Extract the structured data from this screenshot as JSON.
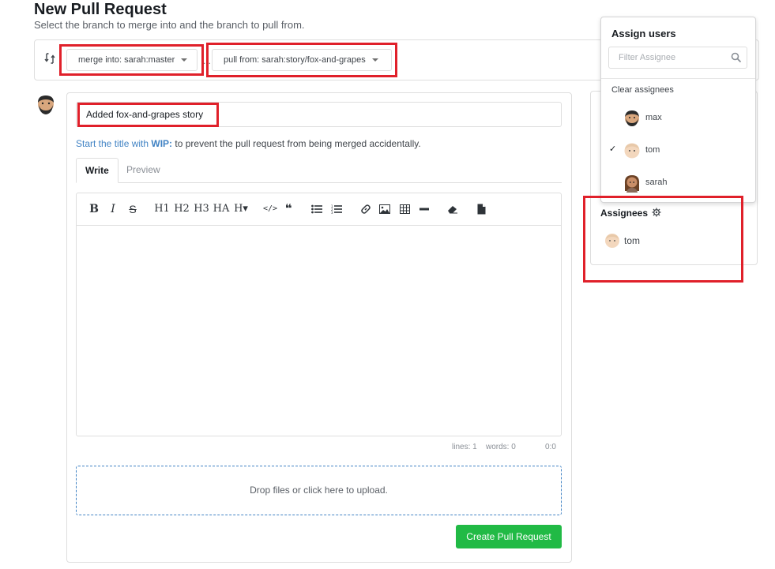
{
  "header": {
    "title": "New Pull Request",
    "subtitle": "Select the branch to merge into and the branch to pull from."
  },
  "branches": {
    "merge_into": "merge into: sarah:master",
    "separator": "...",
    "pull_from": "pull from: sarah:story/fox-and-grapes"
  },
  "form": {
    "title_value": "Added fox-and-grapes story",
    "wip_prefix": "Start the title with",
    "wip_keyword": "WIP:",
    "wip_suffix": "to prevent the pull request from being merged accidentally.",
    "tabs": [
      "Write",
      "Preview"
    ],
    "toolbar": {
      "bold": "B",
      "italic": "I",
      "strikethrough": "S",
      "h1": "H1",
      "h2": "H2",
      "h3": "H3",
      "h_bigger": "HA",
      "h_smaller": "H▾",
      "code": "</>",
      "quote": "❝",
      "unordered_list": "unordered-list-icon",
      "ordered_list": "ordered-list-icon",
      "link": "link-icon",
      "image": "image-icon",
      "table": "table-icon",
      "horizontal_rule": "horizontal-rule-icon",
      "eraser": "eraser-icon",
      "file": "file-icon"
    },
    "editor_status": {
      "lines": "lines: 1",
      "words": "words: 0",
      "cursor": "0:0"
    },
    "dropzone_text": "Drop files or click here to upload.",
    "submit_label": "Create Pull Request"
  },
  "sidebar": {
    "assignees_title": "Assignees",
    "assignees": [
      {
        "name": "tom"
      }
    ]
  },
  "dropdown": {
    "header": "Assign users",
    "filter_placeholder": "Filter Assignee",
    "clear_label": "Clear assignees",
    "users": [
      {
        "name": "max",
        "checked": false
      },
      {
        "name": "tom",
        "checked": true
      },
      {
        "name": "sarah",
        "checked": false
      }
    ]
  },
  "colors": {
    "accent_blue": "#4183c4",
    "create_button": "#21ba45",
    "annotation_red": "#e0202a"
  }
}
